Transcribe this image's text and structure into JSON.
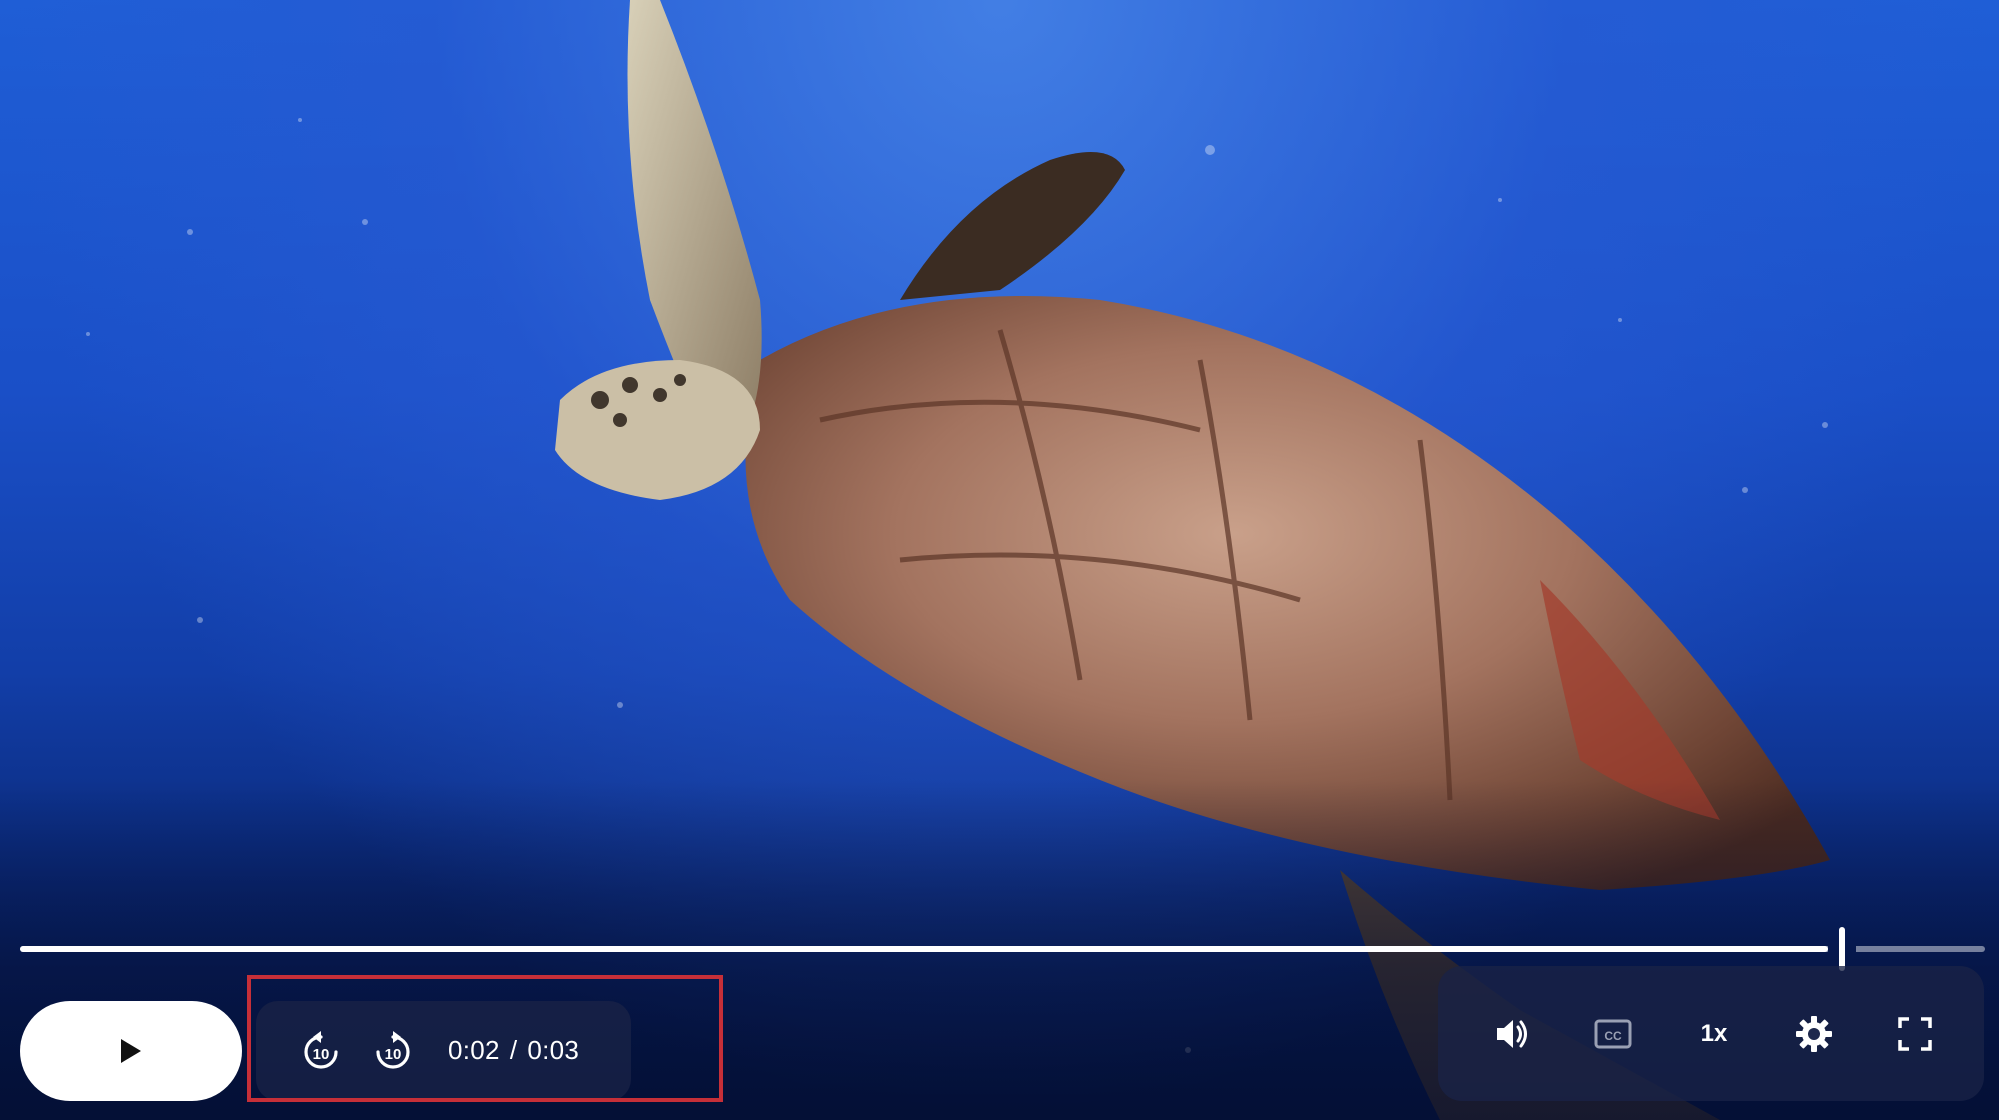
{
  "player": {
    "current_time": "0:02",
    "separator": "/",
    "duration": "0:03",
    "progress_fraction": 0.927,
    "speed_label": "1x"
  },
  "controls_left": {
    "play_icon": "play-icon",
    "skip_back_icon": "replay-10-icon",
    "skip_forward_icon": "forward-10-icon"
  },
  "controls_right": {
    "volume_icon": "volume-icon",
    "captions_icon": "captions-icon",
    "settings_icon": "gear-icon",
    "fullscreen_icon": "fullscreen-icon"
  },
  "colors": {
    "highlight_border": "#c62f38",
    "progress_fill": "#ffffff",
    "controls_bg": "#19234a"
  }
}
